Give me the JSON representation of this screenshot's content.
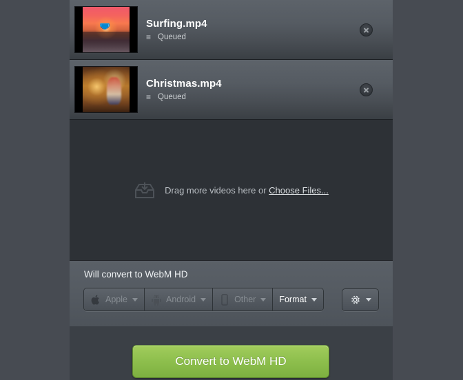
{
  "window": {
    "background_color": "#474b52",
    "panel_color": "#2d3136"
  },
  "file_list": {
    "items": [
      {
        "name": "Surfing.mp4",
        "status": "Queued",
        "status_icon": "hamburger-icon",
        "thumbnail": "sunset-surfing-thumbnail",
        "remove_icon": "close-circle-icon"
      },
      {
        "name": "Christmas.mp4",
        "status": "Queued",
        "status_icon": "hamburger-icon",
        "thumbnail": "christmas-tree-thumbnail",
        "remove_icon": "close-circle-icon"
      }
    ]
  },
  "drop_zone": {
    "icon": "inbox-download-icon",
    "text": "Drag more videos here or",
    "link_label": "Choose Files..."
  },
  "settings_bar": {
    "convert_label": "Will convert to WebM HD",
    "presets": [
      {
        "label": "Apple",
        "icon": "apple-icon",
        "enabled": false,
        "caret": "chevron-down-icon"
      },
      {
        "label": "Android",
        "icon": "android-icon",
        "enabled": false,
        "caret": "chevron-down-icon"
      },
      {
        "label": "Other",
        "icon": "phone-icon",
        "enabled": false,
        "caret": "chevron-down-icon"
      },
      {
        "label": "Format",
        "icon": "",
        "enabled": true,
        "caret": "chevron-down-icon"
      }
    ],
    "gear": {
      "icon": "gear-icon",
      "caret": "chevron-down-icon"
    }
  },
  "footer": {
    "convert_button_label": "Convert to WebM HD",
    "convert_button_color": "#8fc04e"
  }
}
